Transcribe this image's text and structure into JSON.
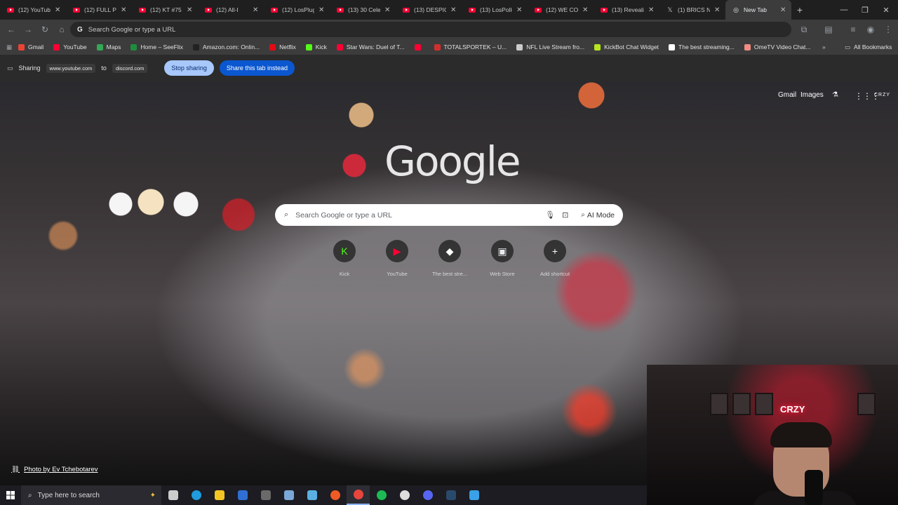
{
  "tabs": [
    {
      "title": "(12) YouTube",
      "fav": "youtube"
    },
    {
      "title": "(12) FULL PU",
      "fav": "youtube"
    },
    {
      "title": "(12) KT #75 I",
      "fav": "youtube"
    },
    {
      "title": "(12) All-I",
      "fav": "youtube"
    },
    {
      "title": "(12) LosPlug",
      "fav": "youtube"
    },
    {
      "title": "(13) 30 Celeb",
      "fav": "youtube"
    },
    {
      "title": "(13) DESPICA",
      "fav": "youtube"
    },
    {
      "title": "(13) LosPollo",
      "fav": "youtube"
    },
    {
      "title": "(12) WE COU",
      "fav": "youtube"
    },
    {
      "title": "(13) Revealin",
      "fav": "youtube"
    },
    {
      "title": "(1) BRICS Ne",
      "fav": "x"
    },
    {
      "title": "New Tab",
      "fav": "chrome"
    }
  ],
  "window_controls": {
    "minimize": "—",
    "restore": "❐",
    "close": "✕"
  },
  "omnibox": {
    "placeholder": "Search Google or type a URL"
  },
  "bookmarks": [
    {
      "label": "Gmail",
      "color": "#ea4335"
    },
    {
      "label": "YouTube",
      "color": "#ff0033"
    },
    {
      "label": "Maps",
      "color": "#34a853"
    },
    {
      "label": "Home – SeeFlix",
      "color": "#1e8e3e"
    },
    {
      "label": "Amazon.com: Onlin...",
      "color": "#222222"
    },
    {
      "label": "Netflix",
      "color": "#e50914"
    },
    {
      "label": "Kick",
      "color": "#53fc18"
    },
    {
      "label": "Star Wars: Duel of T...",
      "color": "#ff0033"
    },
    {
      "label": "",
      "color": "#ff0033"
    },
    {
      "label": "TOTALSPORTEK – U...",
      "color": "#d32f2f"
    },
    {
      "label": "NFL Live Stream fro...",
      "color": "#cccccc"
    },
    {
      "label": "KickBot Chat Widget",
      "color": "#b5e61d"
    },
    {
      "label": "The best streaming...",
      "color": "#ffffff"
    },
    {
      "label": "OmeTV Video Chat...",
      "color": "#f28b82"
    }
  ],
  "bookmarks_overflow": "»",
  "all_bookmarks": "All Bookmarks",
  "sharing": {
    "label": "Sharing",
    "source": "www.youtube.com",
    "to": "to",
    "target": "discord.com",
    "stop_button": "Stop sharing",
    "share_button": "Share this tab instead"
  },
  "ntp": {
    "gmail": "Gmail",
    "images": "Images",
    "profile": "CRZY",
    "logo": "Google",
    "search_placeholder": "Search Google or type a URL",
    "ai_mode": "AI Mode",
    "shortcuts": [
      {
        "label": "Kick",
        "glyph": "K",
        "color": "#53fc18"
      },
      {
        "label": "YouTube",
        "glyph": "▶",
        "color": "#ff0033"
      },
      {
        "label": "The best stre...",
        "glyph": "◆",
        "color": "#ffffff"
      },
      {
        "label": "Web Store",
        "glyph": "▣",
        "color": "#e8eaed"
      },
      {
        "label": "Add shortcut",
        "glyph": "+",
        "color": "#ffffff"
      }
    ],
    "photo_credit": "Photo by Ev Tchebotarev"
  },
  "webcam": {
    "neon_text": "CRZY"
  },
  "taskbar": {
    "search_placeholder": "Type here to search",
    "apps": [
      "task-view",
      "edge",
      "file-explorer",
      "outlook",
      "calculator",
      "paint",
      "notes",
      "brave",
      "chrome",
      "spotify",
      "obs",
      "discord",
      "steam",
      "app"
    ]
  }
}
